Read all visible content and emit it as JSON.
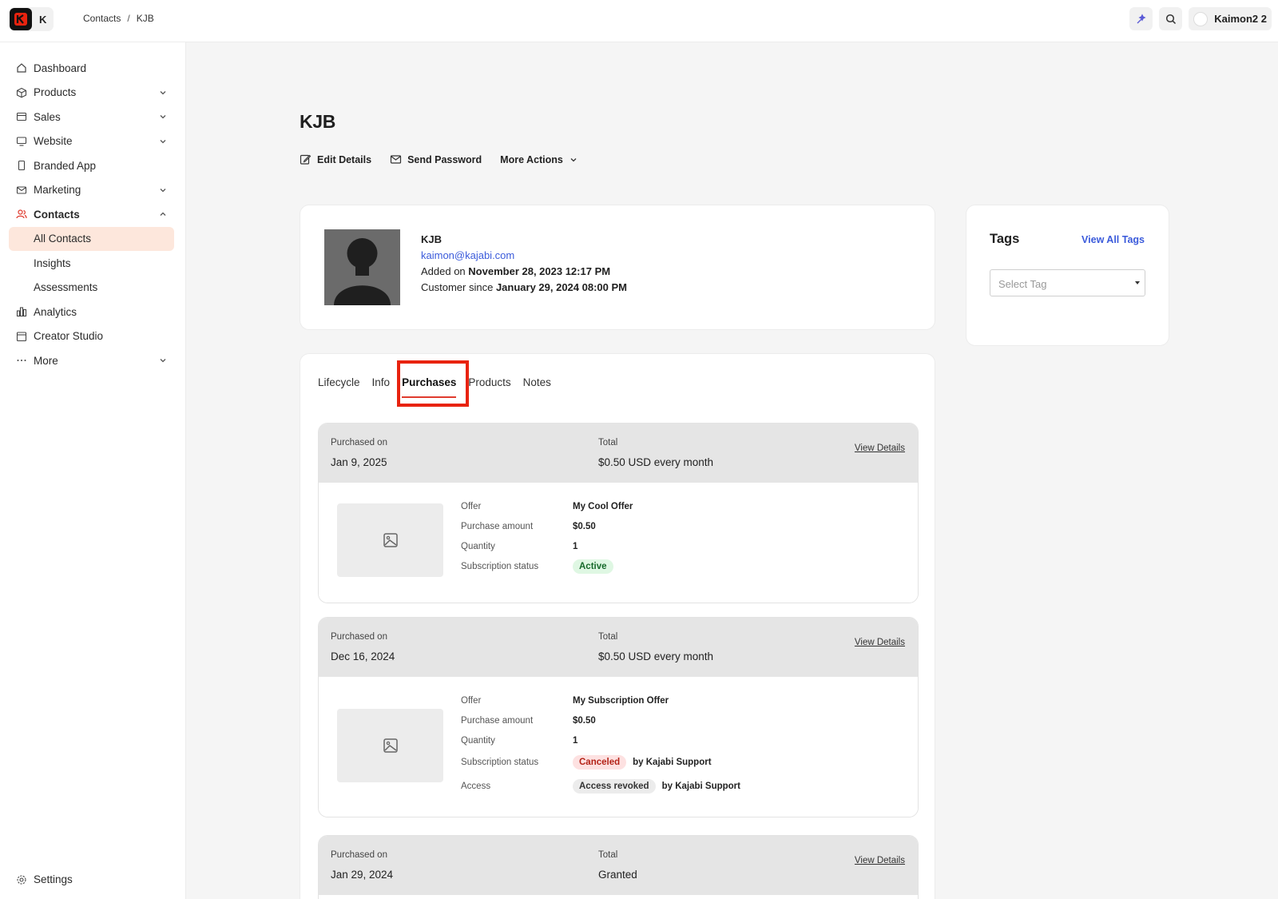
{
  "app": {
    "logo_letter": "K"
  },
  "breadcrumb": {
    "items": [
      "Contacts",
      "KJB"
    ],
    "separator": "/"
  },
  "topbar": {
    "user_name": "Kaimon2 2"
  },
  "sidebar": {
    "items": [
      {
        "label": "Dashboard",
        "icon": "home-icon",
        "expandable": false
      },
      {
        "label": "Products",
        "icon": "box-icon",
        "expandable": true
      },
      {
        "label": "Sales",
        "icon": "sales-icon",
        "expandable": true
      },
      {
        "label": "Website",
        "icon": "monitor-icon",
        "expandable": true
      },
      {
        "label": "Branded App",
        "icon": "phone-icon",
        "expandable": false
      },
      {
        "label": "Marketing",
        "icon": "mail-icon",
        "expandable": true
      },
      {
        "label": "Contacts",
        "icon": "contacts-icon",
        "expandable": true,
        "expanded": true
      },
      {
        "label": "All Contacts",
        "sub": true,
        "active": true
      },
      {
        "label": "Insights",
        "sub": true
      },
      {
        "label": "Assessments",
        "sub": true
      },
      {
        "label": "Analytics",
        "icon": "chart-icon",
        "expandable": false
      },
      {
        "label": "Creator Studio",
        "icon": "calendar-icon",
        "expandable": false
      },
      {
        "label": "More",
        "icon": "dots-icon",
        "expandable": true
      }
    ],
    "settings_label": "Settings"
  },
  "page": {
    "title": "KJB",
    "actions": {
      "edit": "Edit Details",
      "send_password": "Send Password",
      "more": "More Actions"
    }
  },
  "profile": {
    "name": "KJB",
    "email": "kaimon@kajabi.com",
    "added_prefix": "Added on",
    "added_date": "November 28, 2023 12:17 PM",
    "customer_prefix": "Customer since",
    "customer_date": "January 29, 2024 08:00 PM"
  },
  "tags": {
    "title": "Tags",
    "view_all": "View All Tags",
    "select_placeholder": "Select Tag"
  },
  "tabs": [
    "Lifecycle",
    "Info",
    "Purchases",
    "Products",
    "Notes"
  ],
  "active_tab": "Purchases",
  "purchases": [
    {
      "purchased_label": "Purchased on",
      "purchased_on": "Jan 9, 2025",
      "total_label": "Total",
      "total": "$0.50 USD every month",
      "view_details": "View Details",
      "offer_label": "Offer",
      "offer": "My Cool Offer",
      "amount_label": "Purchase amount",
      "amount": "$0.50",
      "quantity_label": "Quantity",
      "quantity": "1",
      "status_label": "Subscription status",
      "status": "Active"
    },
    {
      "purchased_label": "Purchased on",
      "purchased_on": "Dec 16, 2024",
      "total_label": "Total",
      "total": "$0.50 USD every month",
      "view_details": "View Details",
      "offer_label": "Offer",
      "offer": "My Subscription Offer",
      "amount_label": "Purchase amount",
      "amount": "$0.50",
      "quantity_label": "Quantity",
      "quantity": "1",
      "status_label": "Subscription status",
      "status": "Canceled",
      "status_by": "by Kajabi Support",
      "access_label": "Access",
      "access": "Access revoked",
      "access_by": "by Kajabi Support"
    },
    {
      "purchased_label": "Purchased on",
      "purchased_on": "Jan 29, 2024",
      "total_label": "Total",
      "total": "Granted",
      "view_details": "View Details"
    }
  ],
  "colors": {
    "accent": "#e03b2e",
    "link": "#3b5bdb",
    "active_nav_bg": "#fde7dc",
    "highlight": "#e8230f"
  }
}
